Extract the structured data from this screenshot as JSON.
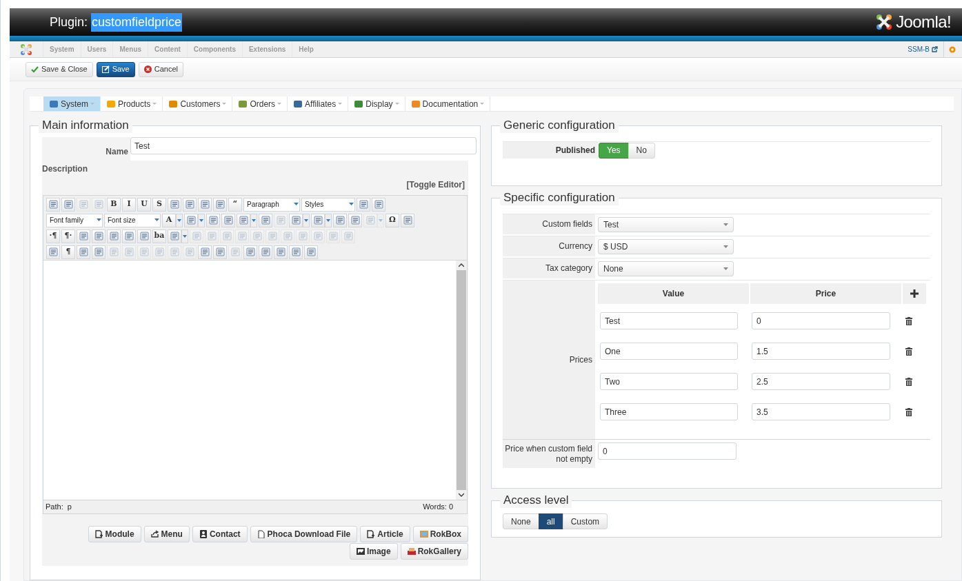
{
  "header": {
    "title_prefix": "Plugin:",
    "title_highlight": "customfieldprice",
    "brand": "Joomla!"
  },
  "menu": {
    "items": [
      "System",
      "Users",
      "Menus",
      "Content",
      "Components",
      "Extensions",
      "Help"
    ],
    "user": "SSM-B"
  },
  "toolbar": [
    {
      "label": "Save & Close",
      "kind": "save_close"
    },
    {
      "label": "Save",
      "kind": "save"
    },
    {
      "label": "Cancel",
      "kind": "cancel"
    }
  ],
  "tabs": [
    {
      "label": "System",
      "selected": true
    },
    {
      "label": "Products",
      "selected": false
    },
    {
      "label": "Customers",
      "selected": false
    },
    {
      "label": "Orders",
      "selected": false
    },
    {
      "label": "Affiliates",
      "selected": false
    },
    {
      "label": "Display",
      "selected": false
    },
    {
      "label": "Documentation",
      "selected": false
    }
  ],
  "main_information": {
    "legend": "Main information",
    "name_label": "Name",
    "name_value": "Test",
    "description_label": "Description",
    "toggle_editor": "[Toggle Editor]",
    "editor": {
      "toolbar_rows": [
        {
          "items": [
            {
              "kind": "icon"
            },
            {
              "kind": "icon"
            },
            {
              "kind": "icon",
              "disabled": true
            },
            {
              "kind": "icon",
              "disabled": true
            },
            {
              "kind": "glyph",
              "text": "B"
            },
            {
              "kind": "glyph",
              "text": "I"
            },
            {
              "kind": "glyph",
              "text": "U"
            },
            {
              "kind": "glyph",
              "text": "S"
            },
            {
              "kind": "icon"
            },
            {
              "kind": "icon"
            },
            {
              "kind": "icon"
            },
            {
              "kind": "icon"
            },
            {
              "kind": "glyph",
              "text": "“"
            },
            {
              "kind": "select",
              "text": "Paragraph"
            },
            {
              "kind": "select",
              "text": "Styles"
            },
            {
              "kind": "icon"
            },
            {
              "kind": "icon"
            }
          ]
        },
        {
          "items": [
            {
              "kind": "select",
              "text": "Font family"
            },
            {
              "kind": "select",
              "text": "Font size"
            },
            {
              "kind": "glyph",
              "text": "A",
              "dropdown": true
            },
            {
              "kind": "icon",
              "dropdown": true
            },
            {
              "kind": "icon"
            },
            {
              "kind": "icon"
            },
            {
              "kind": "icon",
              "dropdown": true
            },
            {
              "kind": "icon"
            },
            {
              "kind": "icon",
              "disabled": true
            },
            {
              "kind": "icon",
              "dropdown": true
            },
            {
              "kind": "icon",
              "dropdown": true
            },
            {
              "kind": "icon"
            },
            {
              "kind": "icon"
            },
            {
              "kind": "icon",
              "disabled": true,
              "dropdown": true
            },
            {
              "kind": "glyph",
              "text": "Ω"
            },
            {
              "kind": "icon"
            }
          ]
        },
        {
          "items": [
            {
              "kind": "glyph",
              "text": "·¶"
            },
            {
              "kind": "glyph",
              "text": "¶·"
            },
            {
              "kind": "icon"
            },
            {
              "kind": "icon"
            },
            {
              "kind": "icon"
            },
            {
              "kind": "icon"
            },
            {
              "kind": "icon"
            },
            {
              "kind": "glyph",
              "text": "ba"
            },
            {
              "kind": "icon",
              "dropdown": true
            },
            {
              "kind": "icon",
              "disabled": true
            },
            {
              "kind": "icon",
              "disabled": true
            },
            {
              "kind": "icon",
              "disabled": true
            },
            {
              "kind": "icon",
              "disabled": true
            },
            {
              "kind": "icon",
              "disabled": true
            },
            {
              "kind": "icon",
              "disabled": true
            },
            {
              "kind": "icon",
              "disabled": true
            },
            {
              "kind": "icon",
              "disabled": true
            },
            {
              "kind": "icon",
              "disabled": true
            },
            {
              "kind": "icon",
              "disabled": true
            },
            {
              "kind": "icon",
              "disabled": true
            }
          ]
        },
        {
          "items": [
            {
              "kind": "icon"
            },
            {
              "kind": "glyph",
              "text": "¶"
            },
            {
              "kind": "icon"
            },
            {
              "kind": "icon"
            },
            {
              "kind": "icon",
              "disabled": true
            },
            {
              "kind": "icon",
              "disabled": true
            },
            {
              "kind": "icon",
              "disabled": true
            },
            {
              "kind": "icon",
              "disabled": true
            },
            {
              "kind": "icon",
              "disabled": true
            },
            {
              "kind": "icon",
              "disabled": true
            },
            {
              "kind": "icon"
            },
            {
              "kind": "icon"
            },
            {
              "kind": "icon",
              "disabled": true
            },
            {
              "kind": "icon"
            },
            {
              "kind": "icon"
            },
            {
              "kind": "icon"
            },
            {
              "kind": "icon"
            },
            {
              "kind": "icon"
            }
          ]
        }
      ],
      "path": "Path:  p",
      "words": "Words: 0"
    },
    "buttons": [
      {
        "label": "Module"
      },
      {
        "label": "Menu"
      },
      {
        "label": "Contact"
      },
      {
        "label": "Phoca Download File"
      },
      {
        "label": "Article"
      },
      {
        "label": "RokBox"
      },
      {
        "label": "Image"
      },
      {
        "label": "RokGallery"
      }
    ]
  },
  "generic_configuration": {
    "legend": "Generic configuration",
    "published": {
      "label": "Published",
      "options": [
        {
          "label": "Yes",
          "selected": true
        },
        {
          "label": "No",
          "selected": false
        }
      ]
    }
  },
  "specific_configuration": {
    "legend": "Specific configuration",
    "fields": [
      {
        "label": "Custom fields",
        "value": "Test"
      },
      {
        "label": "Currency",
        "value": "$ USD"
      },
      {
        "label": "Tax category",
        "value": "None"
      }
    ],
    "prices": {
      "label": "Prices",
      "columns": [
        "Value",
        "Price"
      ],
      "rows": [
        {
          "value": "Test",
          "price": "0"
        },
        {
          "value": "One",
          "price": "1.5"
        },
        {
          "value": "Two",
          "price": "2.5"
        },
        {
          "value": "Three",
          "price": "3.5"
        }
      ]
    },
    "price_when": {
      "label": "Price when custom field not empty",
      "value": "0"
    }
  },
  "access_level": {
    "legend": "Access level",
    "options": [
      {
        "label": "None",
        "selected": false
      },
      {
        "label": "all",
        "selected": true
      },
      {
        "label": "Custom",
        "selected": false
      }
    ]
  }
}
